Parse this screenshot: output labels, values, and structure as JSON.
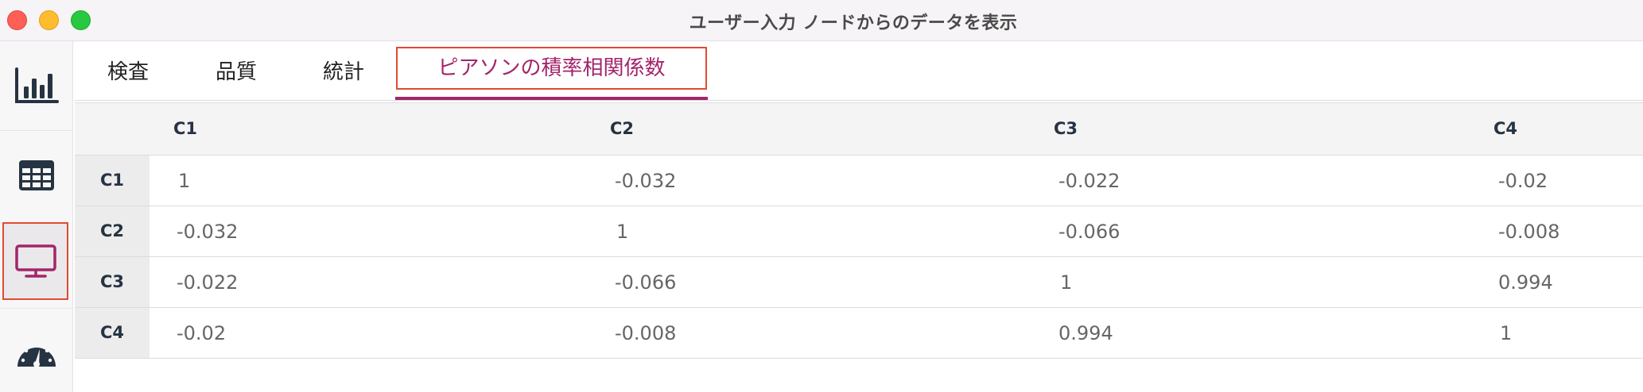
{
  "window": {
    "title": "ユーザー入力 ノードからのデータを表示"
  },
  "sidebar": {
    "items": [
      {
        "icon": "bar-chart-icon",
        "active": false
      },
      {
        "icon": "table-grid-icon",
        "active": false
      },
      {
        "icon": "monitor-icon",
        "active": true
      },
      {
        "icon": "speedometer-icon",
        "active": false
      }
    ]
  },
  "tabs": [
    {
      "label": "検査"
    },
    {
      "label": "品質"
    },
    {
      "label": "統計"
    },
    {
      "label": "ピアソンの積率相関係数"
    }
  ],
  "active_tab": "ピアソンの積率相関係数",
  "colors": {
    "accent": "#a3256a",
    "highlight_border": "#e04b33",
    "header_text": "#263342"
  },
  "table": {
    "columns": [
      "C1",
      "C2",
      "C3",
      "C4"
    ],
    "rows": [
      {
        "label": "C1",
        "values": [
          "1",
          "-0.032",
          "-0.022",
          "-0.02"
        ]
      },
      {
        "label": "C2",
        "values": [
          "-0.032",
          "1",
          "-0.066",
          "-0.008"
        ]
      },
      {
        "label": "C3",
        "values": [
          "-0.022",
          "-0.066",
          "1",
          "0.994"
        ]
      },
      {
        "label": "C4",
        "values": [
          "-0.02",
          "-0.008",
          "0.994",
          "1"
        ]
      }
    ]
  }
}
